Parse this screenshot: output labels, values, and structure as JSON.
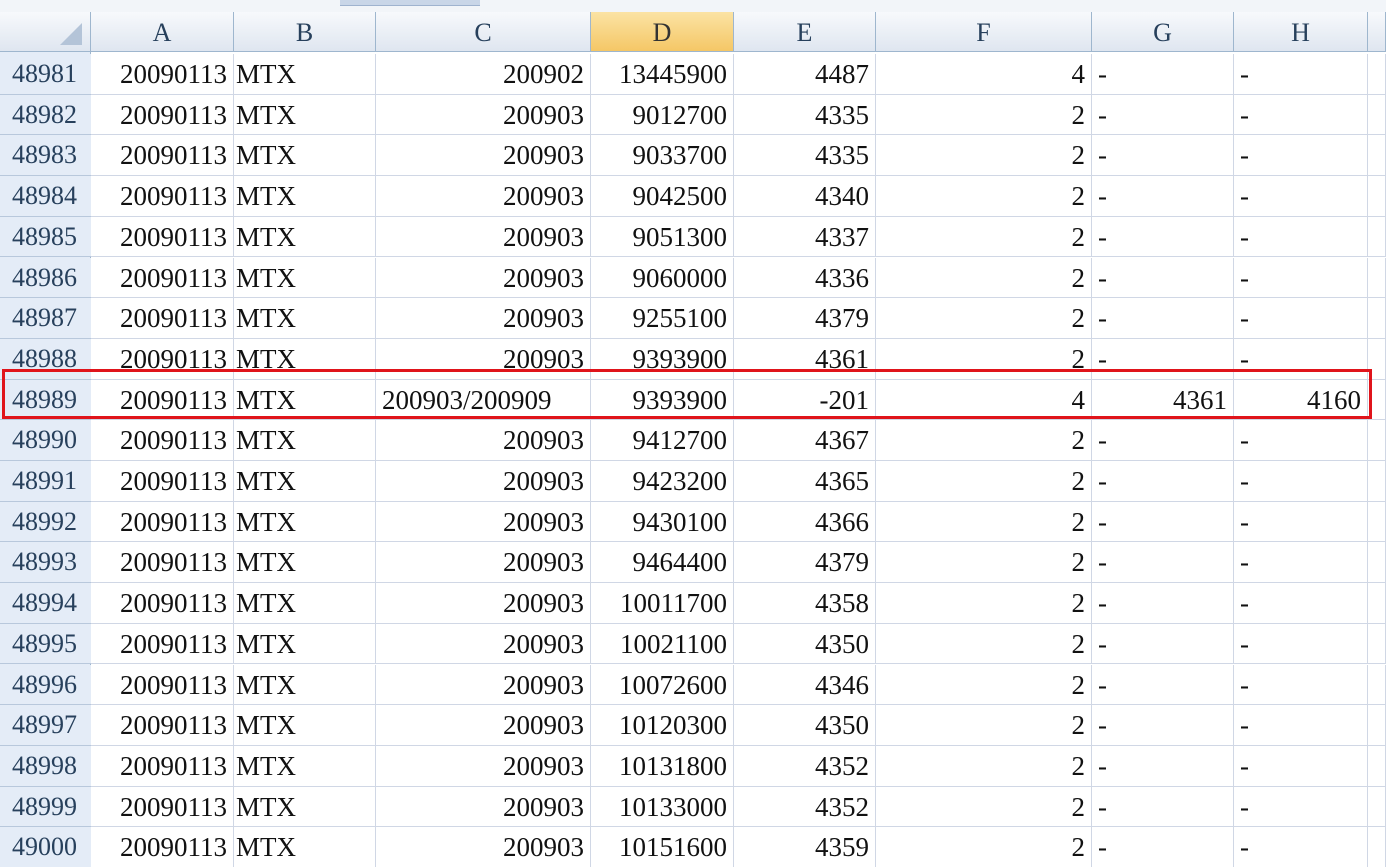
{
  "columns": [
    "A",
    "B",
    "C",
    "D",
    "E",
    "F",
    "G",
    "H"
  ],
  "selected_column": "D",
  "rows": [
    {
      "num": "48981",
      "A": "20090113",
      "B": "MTX",
      "C": "200902",
      "D": "13445900",
      "E": "4487",
      "F": "4",
      "G": "-",
      "H": "-"
    },
    {
      "num": "48982",
      "A": "20090113",
      "B": "MTX",
      "C": "200903",
      "D": "9012700",
      "E": "4335",
      "F": "2",
      "G": "-",
      "H": "-"
    },
    {
      "num": "48983",
      "A": "20090113",
      "B": "MTX",
      "C": "200903",
      "D": "9033700",
      "E": "4335",
      "F": "2",
      "G": "-",
      "H": "-"
    },
    {
      "num": "48984",
      "A": "20090113",
      "B": "MTX",
      "C": "200903",
      "D": "9042500",
      "E": "4340",
      "F": "2",
      "G": "-",
      "H": "-"
    },
    {
      "num": "48985",
      "A": "20090113",
      "B": "MTX",
      "C": "200903",
      "D": "9051300",
      "E": "4337",
      "F": "2",
      "G": "-",
      "H": "-"
    },
    {
      "num": "48986",
      "A": "20090113",
      "B": "MTX",
      "C": "200903",
      "D": "9060000",
      "E": "4336",
      "F": "2",
      "G": "-",
      "H": "-"
    },
    {
      "num": "48987",
      "A": "20090113",
      "B": "MTX",
      "C": "200903",
      "D": "9255100",
      "E": "4379",
      "F": "2",
      "G": "-",
      "H": "-"
    },
    {
      "num": "48988",
      "A": "20090113",
      "B": "MTX",
      "C": "200903",
      "D": "9393900",
      "E": "4361",
      "F": "2",
      "G": "-",
      "H": "-"
    },
    {
      "num": "48989",
      "A": "20090113",
      "B": "MTX",
      "C": "200903/200909",
      "D": "9393900",
      "E": "-201",
      "F": "4",
      "G": "4361",
      "H": "4160"
    },
    {
      "num": "48990",
      "A": "20090113",
      "B": "MTX",
      "C": "200903",
      "D": "9412700",
      "E": "4367",
      "F": "2",
      "G": "-",
      "H": "-"
    },
    {
      "num": "48991",
      "A": "20090113",
      "B": "MTX",
      "C": "200903",
      "D": "9423200",
      "E": "4365",
      "F": "2",
      "G": "-",
      "H": "-"
    },
    {
      "num": "48992",
      "A": "20090113",
      "B": "MTX",
      "C": "200903",
      "D": "9430100",
      "E": "4366",
      "F": "2",
      "G": "-",
      "H": "-"
    },
    {
      "num": "48993",
      "A": "20090113",
      "B": "MTX",
      "C": "200903",
      "D": "9464400",
      "E": "4379",
      "F": "2",
      "G": "-",
      "H": "-"
    },
    {
      "num": "48994",
      "A": "20090113",
      "B": "MTX",
      "C": "200903",
      "D": "10011700",
      "E": "4358",
      "F": "2",
      "G": "-",
      "H": "-"
    },
    {
      "num": "48995",
      "A": "20090113",
      "B": "MTX",
      "C": "200903",
      "D": "10021100",
      "E": "4350",
      "F": "2",
      "G": "-",
      "H": "-"
    },
    {
      "num": "48996",
      "A": "20090113",
      "B": "MTX",
      "C": "200903",
      "D": "10072600",
      "E": "4346",
      "F": "2",
      "G": "-",
      "H": "-"
    },
    {
      "num": "48997",
      "A": "20090113",
      "B": "MTX",
      "C": "200903",
      "D": "10120300",
      "E": "4350",
      "F": "2",
      "G": "-",
      "H": "-"
    },
    {
      "num": "48998",
      "A": "20090113",
      "B": "MTX",
      "C": "200903",
      "D": "10131800",
      "E": "4352",
      "F": "2",
      "G": "-",
      "H": "-"
    },
    {
      "num": "48999",
      "A": "20090113",
      "B": "MTX",
      "C": "200903",
      "D": "10133000",
      "E": "4352",
      "F": "2",
      "G": "-",
      "H": "-"
    },
    {
      "num": "49000",
      "A": "20090113",
      "B": "MTX",
      "C": "200903",
      "D": "10151600",
      "E": "4359",
      "F": "2",
      "G": "-",
      "H": "-"
    }
  ],
  "highlighted_row": "48989",
  "colors": {
    "highlight_border": "#e0141b",
    "selected_header": "#f5c766",
    "header_bg": "#dfe6f0"
  }
}
